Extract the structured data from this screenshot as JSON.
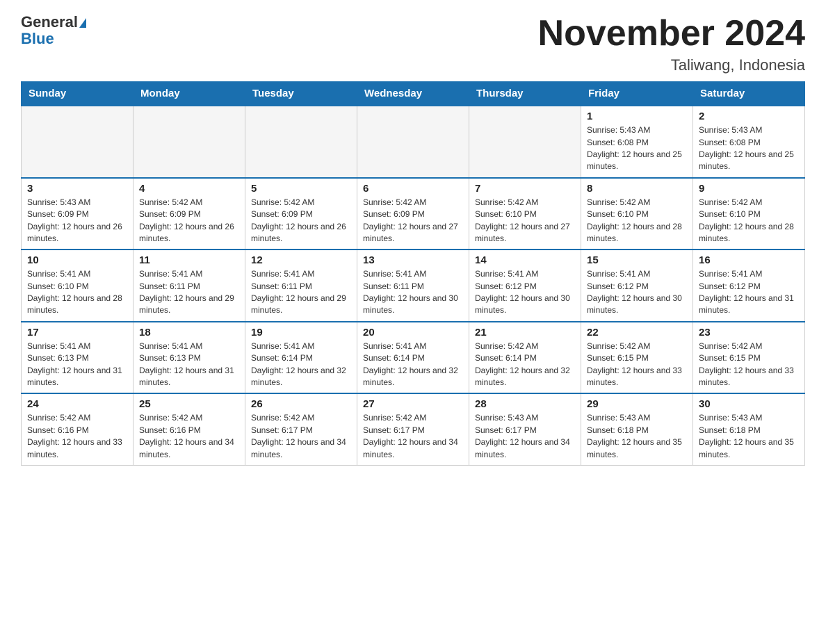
{
  "header": {
    "logo_general": "General",
    "logo_blue": "Blue",
    "title": "November 2024",
    "subtitle": "Taliwang, Indonesia"
  },
  "weekdays": [
    "Sunday",
    "Monday",
    "Tuesday",
    "Wednesday",
    "Thursday",
    "Friday",
    "Saturday"
  ],
  "weeks": [
    [
      {
        "day": "",
        "empty": true
      },
      {
        "day": "",
        "empty": true
      },
      {
        "day": "",
        "empty": true
      },
      {
        "day": "",
        "empty": true
      },
      {
        "day": "",
        "empty": true
      },
      {
        "day": "1",
        "sunrise": "5:43 AM",
        "sunset": "6:08 PM",
        "daylight": "12 hours and 25 minutes."
      },
      {
        "day": "2",
        "sunrise": "5:43 AM",
        "sunset": "6:08 PM",
        "daylight": "12 hours and 25 minutes."
      }
    ],
    [
      {
        "day": "3",
        "sunrise": "5:43 AM",
        "sunset": "6:09 PM",
        "daylight": "12 hours and 26 minutes."
      },
      {
        "day": "4",
        "sunrise": "5:42 AM",
        "sunset": "6:09 PM",
        "daylight": "12 hours and 26 minutes."
      },
      {
        "day": "5",
        "sunrise": "5:42 AM",
        "sunset": "6:09 PM",
        "daylight": "12 hours and 26 minutes."
      },
      {
        "day": "6",
        "sunrise": "5:42 AM",
        "sunset": "6:09 PM",
        "daylight": "12 hours and 27 minutes."
      },
      {
        "day": "7",
        "sunrise": "5:42 AM",
        "sunset": "6:10 PM",
        "daylight": "12 hours and 27 minutes."
      },
      {
        "day": "8",
        "sunrise": "5:42 AM",
        "sunset": "6:10 PM",
        "daylight": "12 hours and 28 minutes."
      },
      {
        "day": "9",
        "sunrise": "5:42 AM",
        "sunset": "6:10 PM",
        "daylight": "12 hours and 28 minutes."
      }
    ],
    [
      {
        "day": "10",
        "sunrise": "5:41 AM",
        "sunset": "6:10 PM",
        "daylight": "12 hours and 28 minutes."
      },
      {
        "day": "11",
        "sunrise": "5:41 AM",
        "sunset": "6:11 PM",
        "daylight": "12 hours and 29 minutes."
      },
      {
        "day": "12",
        "sunrise": "5:41 AM",
        "sunset": "6:11 PM",
        "daylight": "12 hours and 29 minutes."
      },
      {
        "day": "13",
        "sunrise": "5:41 AM",
        "sunset": "6:11 PM",
        "daylight": "12 hours and 30 minutes."
      },
      {
        "day": "14",
        "sunrise": "5:41 AM",
        "sunset": "6:12 PM",
        "daylight": "12 hours and 30 minutes."
      },
      {
        "day": "15",
        "sunrise": "5:41 AM",
        "sunset": "6:12 PM",
        "daylight": "12 hours and 30 minutes."
      },
      {
        "day": "16",
        "sunrise": "5:41 AM",
        "sunset": "6:12 PM",
        "daylight": "12 hours and 31 minutes."
      }
    ],
    [
      {
        "day": "17",
        "sunrise": "5:41 AM",
        "sunset": "6:13 PM",
        "daylight": "12 hours and 31 minutes."
      },
      {
        "day": "18",
        "sunrise": "5:41 AM",
        "sunset": "6:13 PM",
        "daylight": "12 hours and 31 minutes."
      },
      {
        "day": "19",
        "sunrise": "5:41 AM",
        "sunset": "6:14 PM",
        "daylight": "12 hours and 32 minutes."
      },
      {
        "day": "20",
        "sunrise": "5:41 AM",
        "sunset": "6:14 PM",
        "daylight": "12 hours and 32 minutes."
      },
      {
        "day": "21",
        "sunrise": "5:42 AM",
        "sunset": "6:14 PM",
        "daylight": "12 hours and 32 minutes."
      },
      {
        "day": "22",
        "sunrise": "5:42 AM",
        "sunset": "6:15 PM",
        "daylight": "12 hours and 33 minutes."
      },
      {
        "day": "23",
        "sunrise": "5:42 AM",
        "sunset": "6:15 PM",
        "daylight": "12 hours and 33 minutes."
      }
    ],
    [
      {
        "day": "24",
        "sunrise": "5:42 AM",
        "sunset": "6:16 PM",
        "daylight": "12 hours and 33 minutes."
      },
      {
        "day": "25",
        "sunrise": "5:42 AM",
        "sunset": "6:16 PM",
        "daylight": "12 hours and 34 minutes."
      },
      {
        "day": "26",
        "sunrise": "5:42 AM",
        "sunset": "6:17 PM",
        "daylight": "12 hours and 34 minutes."
      },
      {
        "day": "27",
        "sunrise": "5:42 AM",
        "sunset": "6:17 PM",
        "daylight": "12 hours and 34 minutes."
      },
      {
        "day": "28",
        "sunrise": "5:43 AM",
        "sunset": "6:17 PM",
        "daylight": "12 hours and 34 minutes."
      },
      {
        "day": "29",
        "sunrise": "5:43 AM",
        "sunset": "6:18 PM",
        "daylight": "12 hours and 35 minutes."
      },
      {
        "day": "30",
        "sunrise": "5:43 AM",
        "sunset": "6:18 PM",
        "daylight": "12 hours and 35 minutes."
      }
    ]
  ]
}
